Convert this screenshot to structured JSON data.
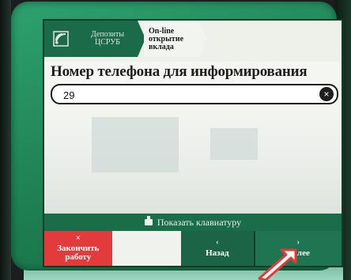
{
  "breadcrumb": {
    "level1": "Депозиты\nЦСРУБ",
    "level2": "On-line\nоткрытие\nвклада"
  },
  "page_title": "Номер телефона для информирования",
  "phone_field": {
    "value": "29",
    "clear_symbol": "×"
  },
  "keyboard_bar": {
    "label": "Показать клавиатуру"
  },
  "buttons": {
    "finish": {
      "symbol": "×",
      "label": "Закончить работу"
    },
    "back": {
      "symbol": "‹",
      "label": "Назад"
    },
    "next": {
      "symbol": "›",
      "label": "Далее"
    }
  },
  "colors": {
    "kiosk_green": "#1d7f52",
    "nav_green": "#1b6b49",
    "finish_red": "#e23b3b",
    "arrow_red": "#e53935"
  }
}
